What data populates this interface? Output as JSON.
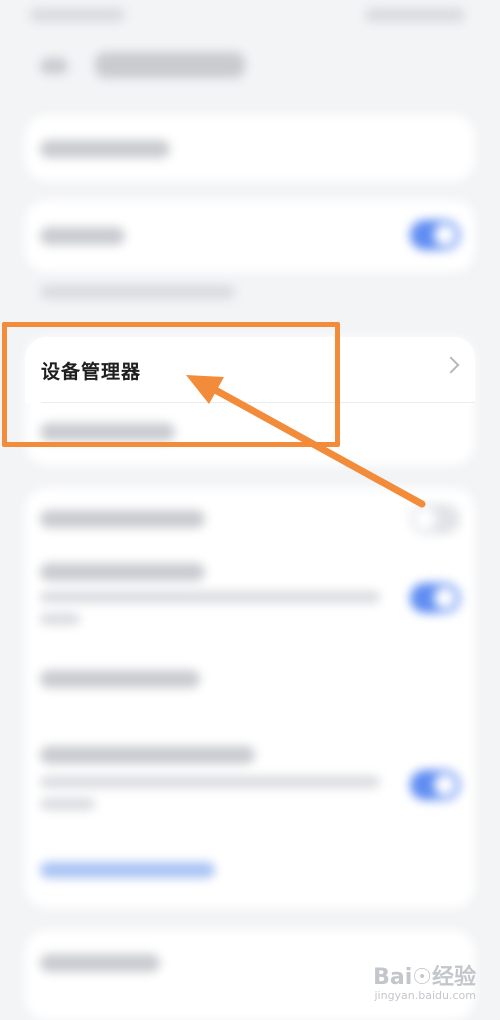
{
  "settings_row": {
    "label": "设备管理器"
  },
  "watermark": {
    "logo": "Bai☉经验",
    "url": "jingyan.baidu.com"
  },
  "colors": {
    "accent": "#5f8df2",
    "highlight": "#f28b3a",
    "background": "#f3f4f6"
  },
  "icons": {
    "back": "back-arrow-icon",
    "chevron": "chevron-right-icon",
    "pointer": "pointer-arrow-icon"
  }
}
